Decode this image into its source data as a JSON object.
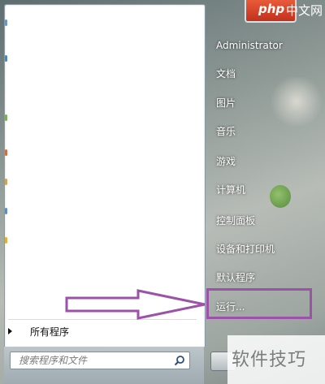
{
  "right_menu": {
    "user": "Administrator",
    "items": [
      "文档",
      "图片",
      "音乐",
      "游戏",
      "计算机",
      "控制面板",
      "设备和打印机",
      "默认程序",
      "运行..."
    ]
  },
  "left_pane": {
    "all_programs": "所有程序",
    "search_placeholder": "搜索程序和文件"
  },
  "watermarks": {
    "top_logo": "php",
    "top_text": "中文网",
    "bottom_text": "软件技巧"
  },
  "colors": {
    "highlight": "#9b52a8",
    "logo_bg": "#d9412a"
  },
  "icons": [
    "search-icon",
    "arrow-right-icon",
    "triangle-right-icon",
    "shutdown-icon"
  ]
}
